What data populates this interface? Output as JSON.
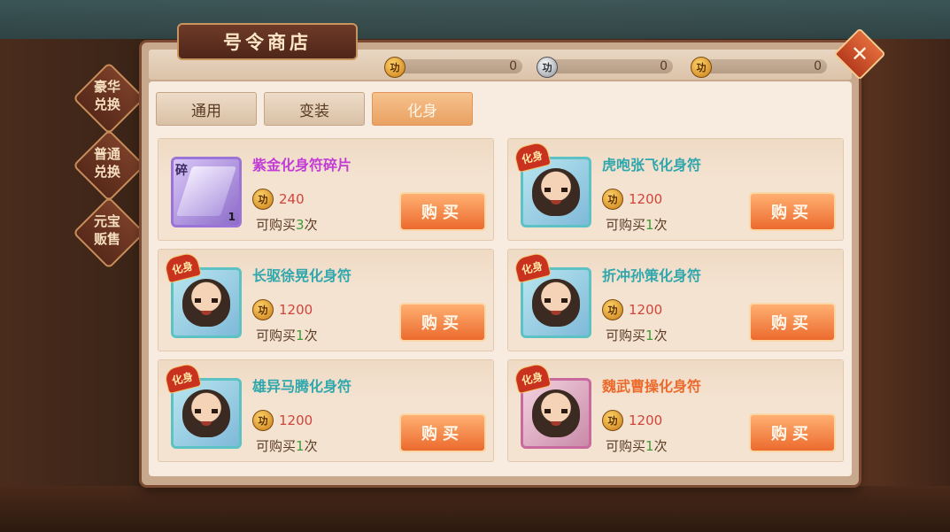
{
  "title": "号令商店",
  "close_icon": "✕",
  "currencies": [
    {
      "icon": "功",
      "type": "gold",
      "value": "0"
    },
    {
      "icon": "功",
      "type": "silver",
      "value": "0"
    },
    {
      "icon": "功",
      "type": "gold",
      "value": "0"
    }
  ],
  "side_tabs": [
    {
      "label": "豪华\n兑换",
      "active": true
    },
    {
      "label": "普通\n兑换",
      "active": false
    },
    {
      "label": "元宝\n贩售",
      "active": false
    }
  ],
  "category_tabs": [
    {
      "label": "通用",
      "active": false
    },
    {
      "label": "变装",
      "active": false
    },
    {
      "label": "化身",
      "active": true
    }
  ],
  "items": [
    {
      "name": "紫金化身符碎片",
      "name_color": "#c23cd6",
      "price": "240",
      "coin_icon": "功",
      "limit_prefix": "可购买",
      "limit_count": "3",
      "limit_suffix": "次",
      "buy_label": "购买",
      "badge": "",
      "shard_tag": "碎",
      "quantity": "1",
      "frame": "purple"
    },
    {
      "name": "虎咆张飞化身符",
      "name_color": "#2fa7ad",
      "price": "1200",
      "coin_icon": "功",
      "limit_prefix": "可购买",
      "limit_count": "1",
      "limit_suffix": "次",
      "buy_label": "购买",
      "badge": "化身",
      "shard_tag": "",
      "quantity": "",
      "frame": "cyan"
    },
    {
      "name": "长驱徐晃化身符",
      "name_color": "#2fa7ad",
      "price": "1200",
      "coin_icon": "功",
      "limit_prefix": "可购买",
      "limit_count": "1",
      "limit_suffix": "次",
      "buy_label": "购买",
      "badge": "化身",
      "shard_tag": "",
      "quantity": "",
      "frame": "cyan"
    },
    {
      "name": "折冲孙策化身符",
      "name_color": "#2fa7ad",
      "price": "1200",
      "coin_icon": "功",
      "limit_prefix": "可购买",
      "limit_count": "1",
      "limit_suffix": "次",
      "buy_label": "购买",
      "badge": "化身",
      "shard_tag": "",
      "quantity": "",
      "frame": "cyan"
    },
    {
      "name": "雄异马腾化身符",
      "name_color": "#2fa7ad",
      "price": "1200",
      "coin_icon": "功",
      "limit_prefix": "可购买",
      "limit_count": "1",
      "limit_suffix": "次",
      "buy_label": "购买",
      "badge": "化身",
      "shard_tag": "",
      "quantity": "",
      "frame": "cyan"
    },
    {
      "name": "魏武曹操化身符",
      "name_color": "#ec6a2b",
      "price": "1200",
      "coin_icon": "功",
      "limit_prefix": "可购买",
      "limit_count": "1",
      "limit_suffix": "次",
      "buy_label": "购买",
      "badge": "化身",
      "shard_tag": "",
      "quantity": "",
      "frame": "red"
    }
  ]
}
